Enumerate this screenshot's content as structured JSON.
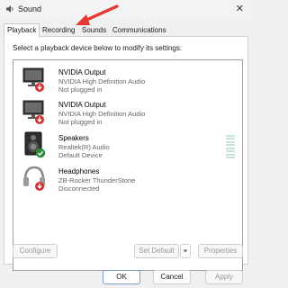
{
  "window": {
    "title": "Sound",
    "close_glyph": "✕"
  },
  "tabs": [
    {
      "label": "Playback",
      "active": true
    },
    {
      "label": "Recording",
      "active": false
    },
    {
      "label": "Sounds",
      "active": false
    },
    {
      "label": "Communications",
      "active": false
    }
  ],
  "instruction": "Select a playback device below to modify its settings:",
  "devices": [
    {
      "name": "NVIDIA Output",
      "detail": "NVIDIA High Definition Audio",
      "status": "Not plugged in",
      "icon": "monitor-icon",
      "badge": "unplugged-badge"
    },
    {
      "name": "NVIDIA Output",
      "detail": "NVIDIA High Definition Audio",
      "status": "Not plugged in",
      "icon": "monitor-icon",
      "badge": "unplugged-badge"
    },
    {
      "name": "Speakers",
      "detail": "Realtek(R) Audio",
      "status": "Default Device",
      "icon": "speaker-icon",
      "badge": "default-check-badge"
    },
    {
      "name": "Headphones",
      "detail": "ZB-Rocker ThunderStone",
      "status": "Disconnected",
      "icon": "headphones-icon",
      "badge": "unplugged-badge"
    }
  ],
  "buttons": {
    "configure": "Configure",
    "set_default": "Set Default",
    "properties": "Properties",
    "ok": "OK",
    "cancel": "Cancel",
    "apply": "Apply"
  },
  "colors": {
    "unplugged_badge": "#d32f2f",
    "default_badge": "#2e8b3a",
    "annotation_arrow": "#e53935"
  }
}
